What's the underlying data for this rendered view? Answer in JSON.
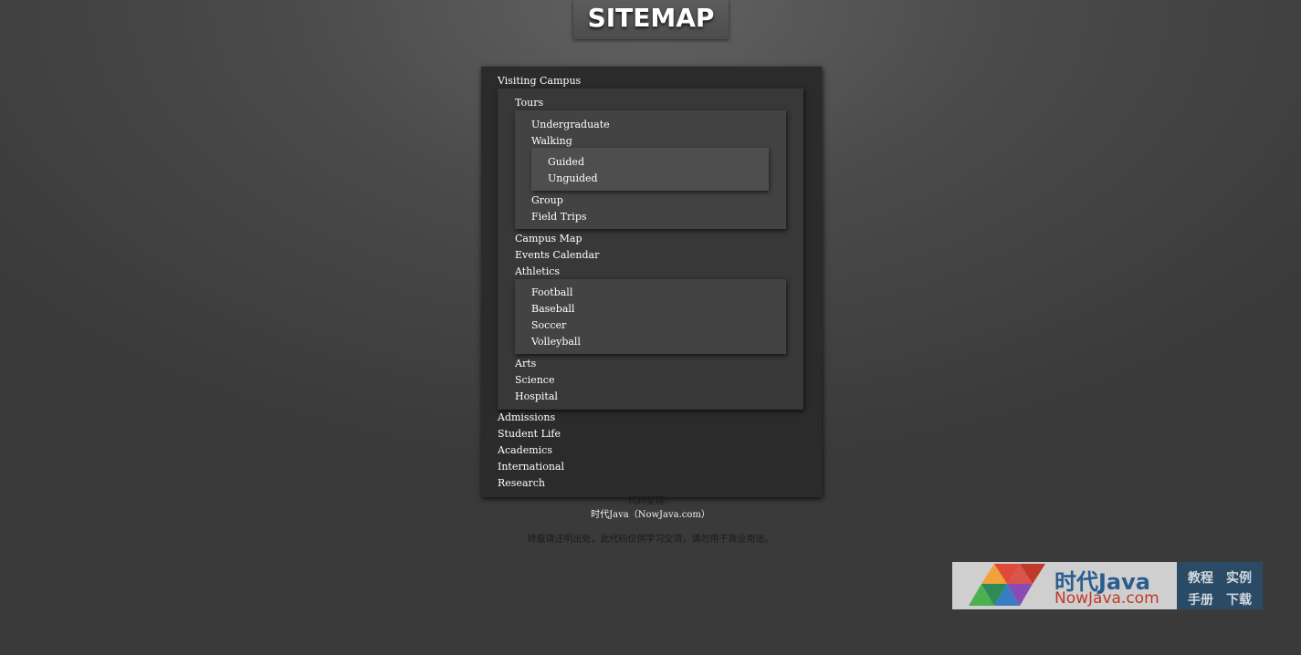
{
  "page_title": "SITEMAP",
  "sitemap": {
    "visiting_campus": "Visiting Campus",
    "tours": "Tours",
    "tours_items": {
      "undergraduate": "Undergraduate",
      "walking": "Walking",
      "guided": "Guided",
      "unguided": "Unguided",
      "group": "Group",
      "field_trips": "Field Trips"
    },
    "campus_map": "Campus Map",
    "events_calendar": "Events Calendar",
    "athletics": "Athletics",
    "athletics_items": [
      "Football",
      "Baseball",
      "Soccer",
      "Volleyball"
    ],
    "arts": "Arts",
    "science": "Science",
    "hospital": "Hospital",
    "top_items": [
      "Admissions",
      "Student Life",
      "Academics",
      "International",
      "Research"
    ]
  },
  "footer": {
    "line1": "代码整理：",
    "line2": "时代Java（NowJava.com）",
    "line3": "转载请注明出处，此代码仅供学习交流，请勿用于商业用途。"
  },
  "banner": {
    "brand_cn": "时代Java",
    "brand_url": "NowJava.com",
    "tags": [
      "教程",
      "实例",
      "手册",
      "下载"
    ],
    "colors": {
      "logo_red": "#e04a3a",
      "logo_blue": "#3a7cc4",
      "logo_green": "#4caf50",
      "logo_purple": "#8a4bb5"
    }
  }
}
